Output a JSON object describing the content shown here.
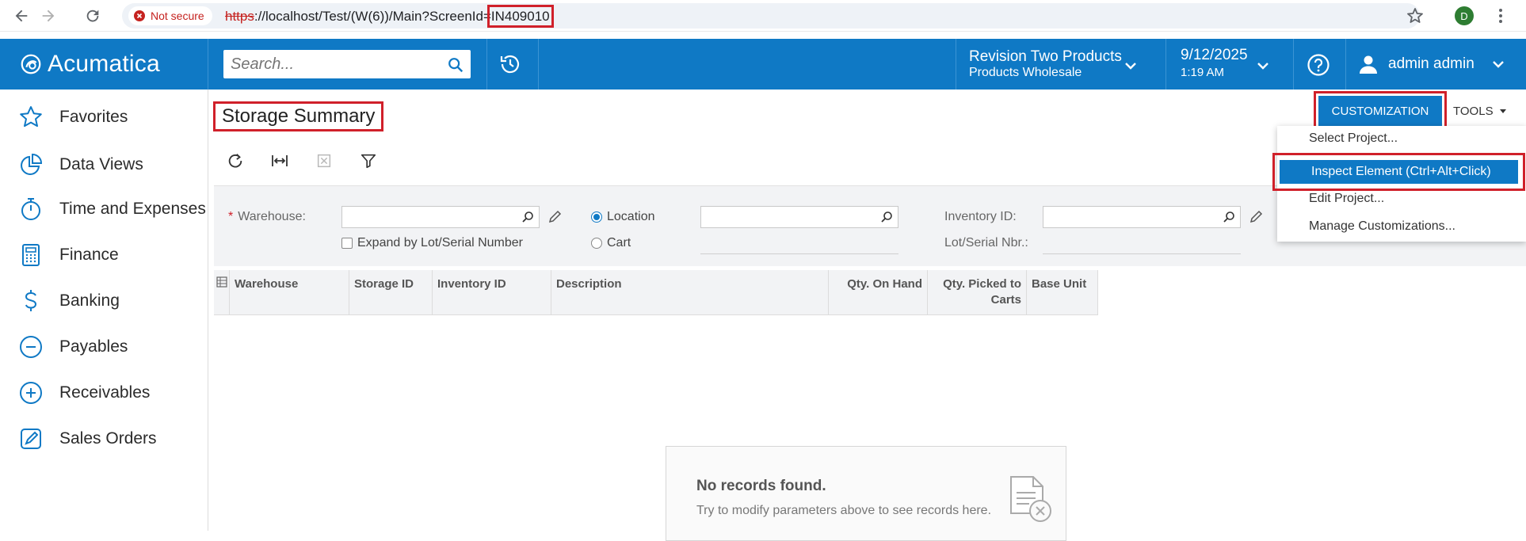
{
  "browser": {
    "security_label": "Not secure",
    "url_scheme": "https",
    "url_middle": "://localhost/Test/(W(6))/Main?ScreenId=",
    "url_screen_id": "IN409010",
    "profile_initial": "D"
  },
  "header": {
    "logo_text": "Acumatica",
    "search_placeholder": "Search...",
    "company_name": "Revision Two Products",
    "branch_name": "Products Wholesale",
    "date": "9/12/2025",
    "time": "1:19 AM",
    "user_name": "admin admin"
  },
  "sidebar": {
    "items": [
      {
        "label": "Favorites",
        "icon": "star-icon"
      },
      {
        "label": "Data Views",
        "icon": "pie-chart-icon"
      },
      {
        "label": "Time and Expenses",
        "icon": "stopwatch-icon"
      },
      {
        "label": "Finance",
        "icon": "calculator-icon"
      },
      {
        "label": "Banking",
        "icon": "dollar-icon"
      },
      {
        "label": "Payables",
        "icon": "minus-circle-icon"
      },
      {
        "label": "Receivables",
        "icon": "plus-circle-icon"
      },
      {
        "label": "Sales Orders",
        "icon": "edit-icon"
      }
    ]
  },
  "page": {
    "title": "Storage Summary",
    "customization_label": "CUSTOMIZATION",
    "tools_label": "TOOLS"
  },
  "filters": {
    "warehouse_label": "Warehouse:",
    "required_mark": "*",
    "expand_label": "Expand by Lot/Serial Number",
    "location_label": "Location",
    "cart_label": "Cart",
    "inventory_label": "Inventory ID:",
    "lot_label": "Lot/Serial Nbr.:"
  },
  "grid": {
    "columns": [
      "Warehouse",
      "Storage ID",
      "Inventory ID",
      "Description",
      "Qty. On Hand",
      "Qty. Picked to Carts",
      "Base Unit"
    ]
  },
  "empty_state": {
    "title": "No records found.",
    "message": "Try to modify parameters above to see records here."
  },
  "tools_menu": {
    "items": [
      "Select Project...",
      "Inspect Element (Ctrl+Alt+Click)",
      "Edit Project...",
      "Manage Customizations..."
    ]
  },
  "colors": {
    "brand": "#0f79c5",
    "highlight": "#d0202a"
  }
}
